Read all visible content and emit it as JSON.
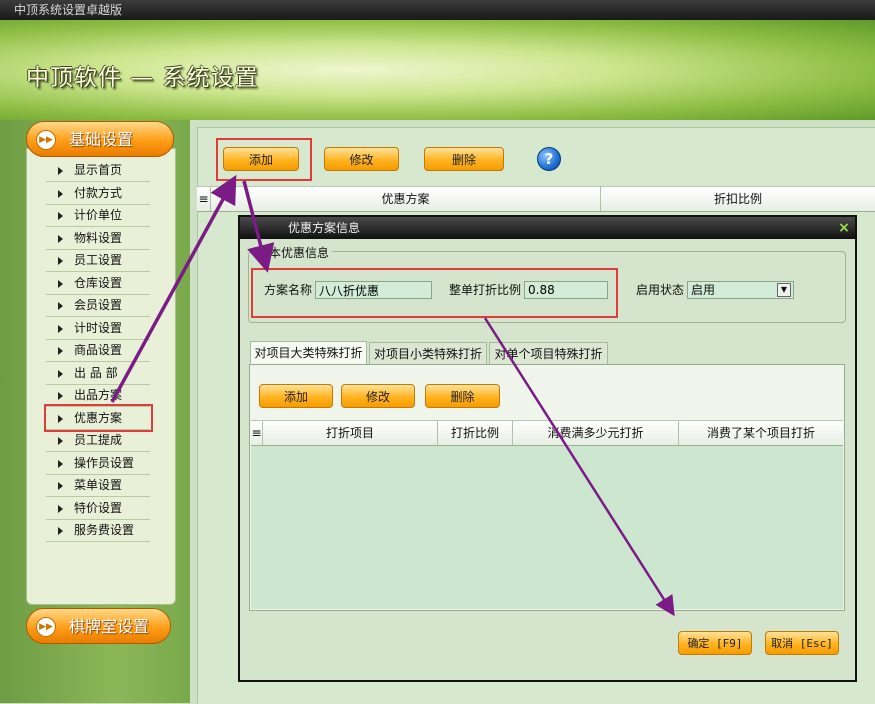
{
  "window": {
    "title": "中顶系统设置卓越版"
  },
  "header": {
    "title": "中顶软件 — 系统设置"
  },
  "sidebar": {
    "section1": "基础设置",
    "section2": "棋牌室设置",
    "items": [
      "显示首页",
      "付款方式",
      "计价单位",
      "物料设置",
      "员工设置",
      "仓库设置",
      "会员设置",
      "计时设置",
      "商品设置",
      "出 品 部",
      "出品方案",
      "优惠方案",
      "员工提成",
      "操作员设置",
      "菜单设置",
      "特价设置",
      "服务费设置"
    ],
    "selected": "优惠方案"
  },
  "toolbar": {
    "add": "添加",
    "edit": "修改",
    "delete": "删除",
    "help": "?"
  },
  "main_grid": {
    "columns": [
      "优惠方案",
      "折扣比例"
    ]
  },
  "dialog": {
    "title": "优惠方案信息",
    "close": "×",
    "group": "基本优惠信息",
    "plan_name_label": "方案名称",
    "plan_name_value": "八八折优惠",
    "discount_label": "整单打折比例",
    "discount_value": "0.88",
    "status_label": "启用状态",
    "status_value": "启用",
    "tabs": [
      "对项目大类特殊打折",
      "对项目小类特殊打折",
      "对单个项目特殊打折"
    ],
    "sub_toolbar": {
      "add": "添加",
      "edit": "修改",
      "delete": "删除"
    },
    "sub_grid": {
      "columns": [
        "打折项目",
        "打折比例",
        "消费满多少元打折",
        "消费了某个项目打折"
      ]
    },
    "ok": "确定 [F9]",
    "cancel": "取消 [Esc]"
  },
  "colors": {
    "accent_orange": "#ffb321",
    "annotation_red": "#e23b3b",
    "annotation_purple": "#7b1b86"
  }
}
